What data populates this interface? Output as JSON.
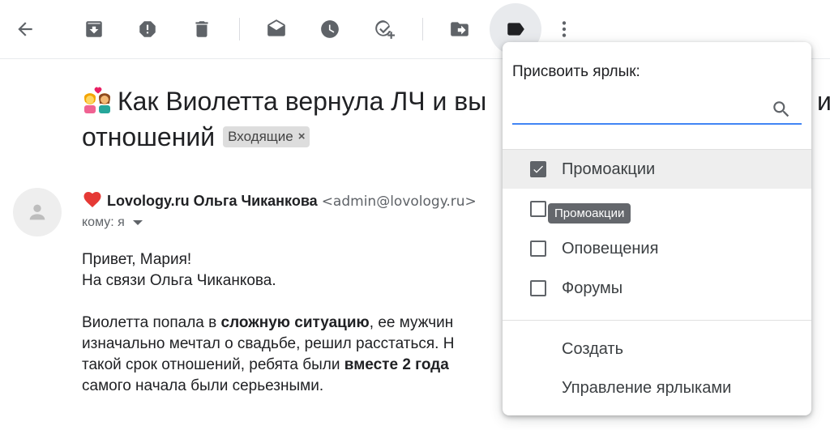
{
  "toolbar": {
    "buttons": [
      {
        "icon": "back-arrow-icon"
      },
      {
        "icon": "archive-icon"
      },
      {
        "icon": "report-spam-icon"
      },
      {
        "icon": "delete-icon"
      },
      {
        "icon": "mark-unread-icon"
      },
      {
        "icon": "snooze-icon"
      },
      {
        "icon": "add-task-icon"
      },
      {
        "icon": "move-to-icon"
      },
      {
        "icon": "label-icon"
      },
      {
        "icon": "more-vert-icon"
      }
    ]
  },
  "email": {
    "subject_line1": "Как Виолетта вернула ЛЧ и вы",
    "subject_line1_tail": "из",
    "subject_line2": "отношений",
    "inbox_badge": "Входящие",
    "badge_close": "×",
    "sender_name": "Lovology.ru Ольга Чиканкова",
    "sender_email": "<admin@lovology.ru>",
    "to_label": "кому: я",
    "greeting": "Привет, Мария!",
    "intro": "На связи Ольга Чиканкова.",
    "para1_a": "Виолетта попала в ",
    "para1_b": "сложную ситуацию",
    "para1_c": ", ее мужчин",
    "para1_line2": "изначально мечтал о свадьбе, решил расстаться. Н",
    "para1_line3_a": "такой срок отношений, ребята были ",
    "para1_line3_b": "вместе 2 года",
    "para1_line4": "самого начала были серьезными."
  },
  "label_menu": {
    "title": "Присвоить ярлык:",
    "search_value": "",
    "options": [
      {
        "label": "Промоакции",
        "checked": true,
        "highlighted": true
      },
      {
        "label": "",
        "checked": false,
        "highlighted": false
      },
      {
        "label": "Оповещения",
        "checked": false,
        "highlighted": false
      },
      {
        "label": "Форумы",
        "checked": false,
        "highlighted": false
      }
    ],
    "actions": [
      "Создать",
      "Управление ярлыками"
    ]
  },
  "tooltip": "Промоакции",
  "colors": {
    "accent": "#4285f4",
    "icon": "#5f6368",
    "heart": "#e53935"
  }
}
